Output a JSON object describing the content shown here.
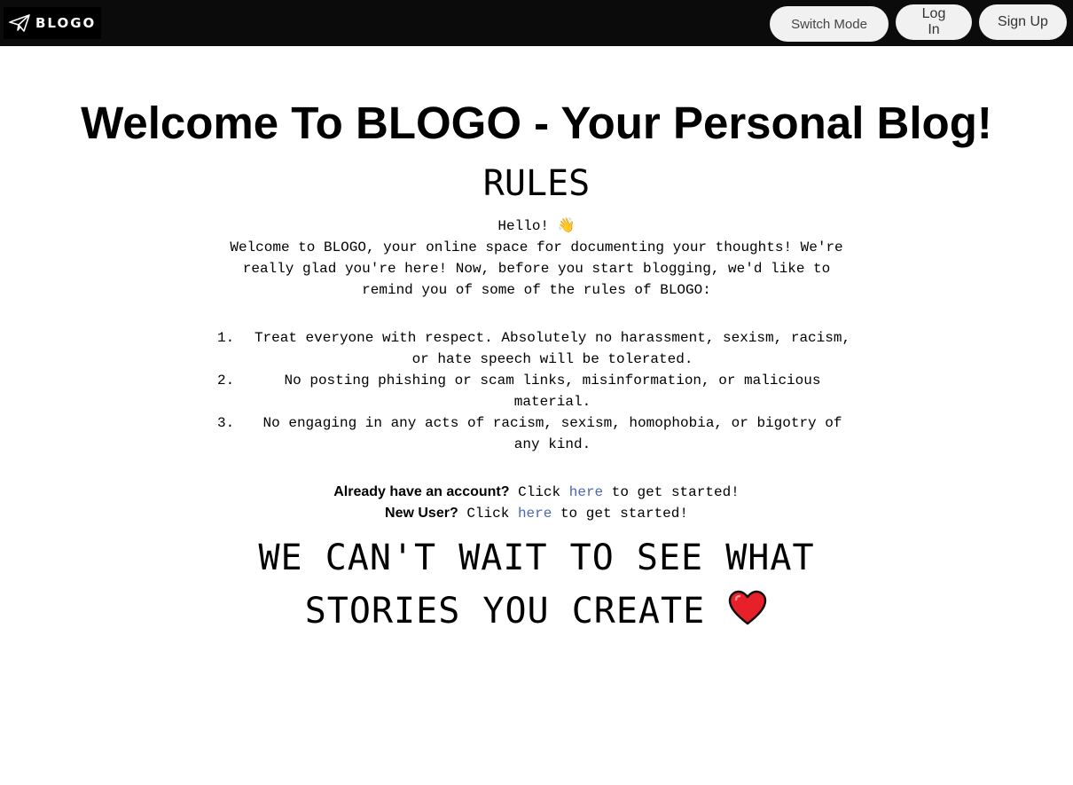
{
  "navbar": {
    "brand": {
      "name": "BLOGO",
      "icon": "paper-plane-icon"
    },
    "buttons": {
      "switch_mode": "Switch Mode",
      "log_in": "Log In",
      "sign_up": "Sign Up"
    }
  },
  "main": {
    "title": "Welcome To BLOGO - Your Personal Blog!",
    "rules_heading": "RULES",
    "greeting": "Hello! 👋",
    "intro": "Welcome to BLOGO, your online space for documenting your thoughts! We're really glad you're here! Now, before you start blogging, we'd like to remind you of some of the rules of BLOGO:",
    "rules": [
      {
        "number": "1.",
        "text": "Treat everyone with respect. Absolutely no harassment, sexism, racism, or hate speech will be tolerated."
      },
      {
        "number": "2.",
        "text": "No posting phishing or scam links, misinformation, or malicious material."
      },
      {
        "number": "3.",
        "text": "No engaging in any acts of racism, sexism, homophobia, or bigotry of any kind."
      }
    ],
    "existing_user": {
      "label": "Already have an account?",
      "pre": " Click ",
      "link": "here",
      "post": " to get started!"
    },
    "new_user": {
      "label": "New User?",
      "pre": " Click ",
      "link": "here",
      "post": " to get started!"
    },
    "closing": "WE CAN'T WAIT TO SEE WHAT STORIES YOU CREATE",
    "closing_icon": "heart-icon"
  },
  "colors": {
    "navbar_bg": "#0b0b0b",
    "pill_bg": "#f1f1f1",
    "link": "#4a67b8",
    "heart": "#e8202a"
  }
}
